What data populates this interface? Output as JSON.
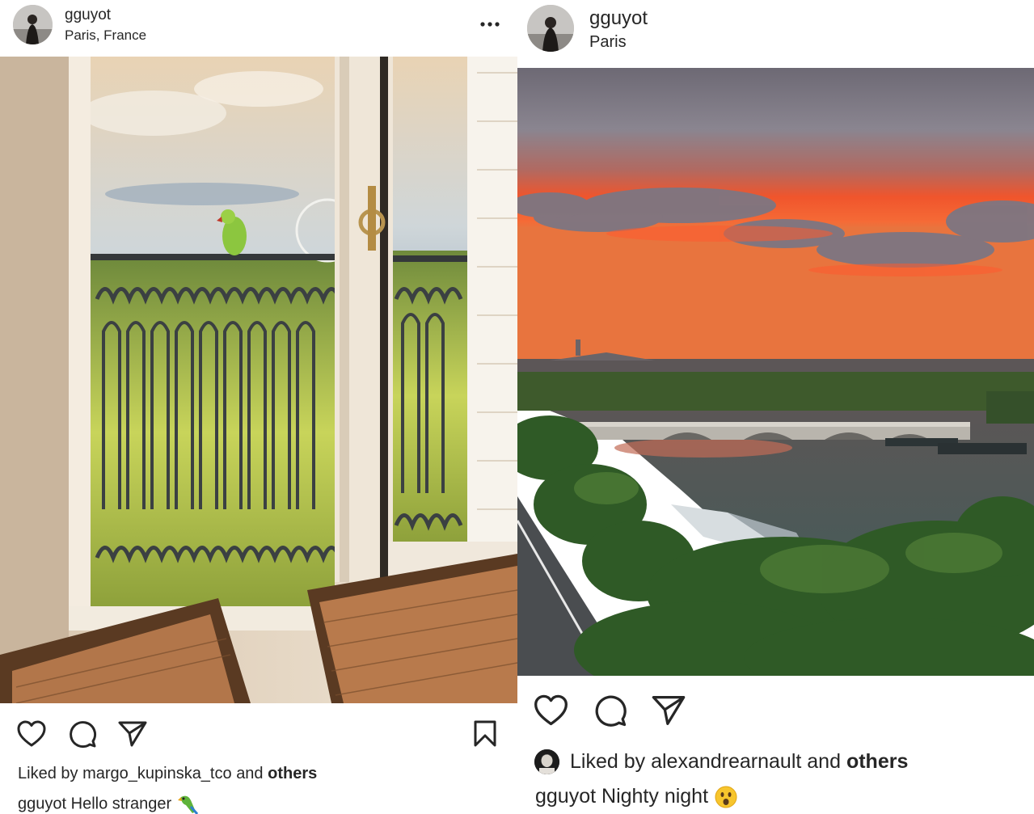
{
  "post_left": {
    "username": "gguyot",
    "location": "Paris, France",
    "more_label": "•••",
    "liked_prefix": "Liked by",
    "liked_user": "margo_kupinska_tco",
    "liked_and": "and",
    "liked_others": "others",
    "caption_user": "gguyot",
    "caption_text": "Hello stranger",
    "caption_emoji": "parrot",
    "photo_subject": "parrot on balcony railing"
  },
  "post_right": {
    "username": "gguyot",
    "location": "Paris",
    "liked_prefix": "Liked by",
    "liked_user": "alexandrearnault",
    "liked_and": "and",
    "liked_others": "others",
    "caption_user": "gguyot",
    "caption_text": "Nighty night",
    "caption_emoji": "surprised-face",
    "photo_subject": "sunset over the Seine"
  },
  "colors": {
    "text": "#262626",
    "sunset_orange": "#f2562b",
    "sky_gray": "#7a7582"
  },
  "icons": [
    "heart-icon",
    "comment-icon",
    "share-icon",
    "bookmark-icon",
    "more-icon"
  ]
}
